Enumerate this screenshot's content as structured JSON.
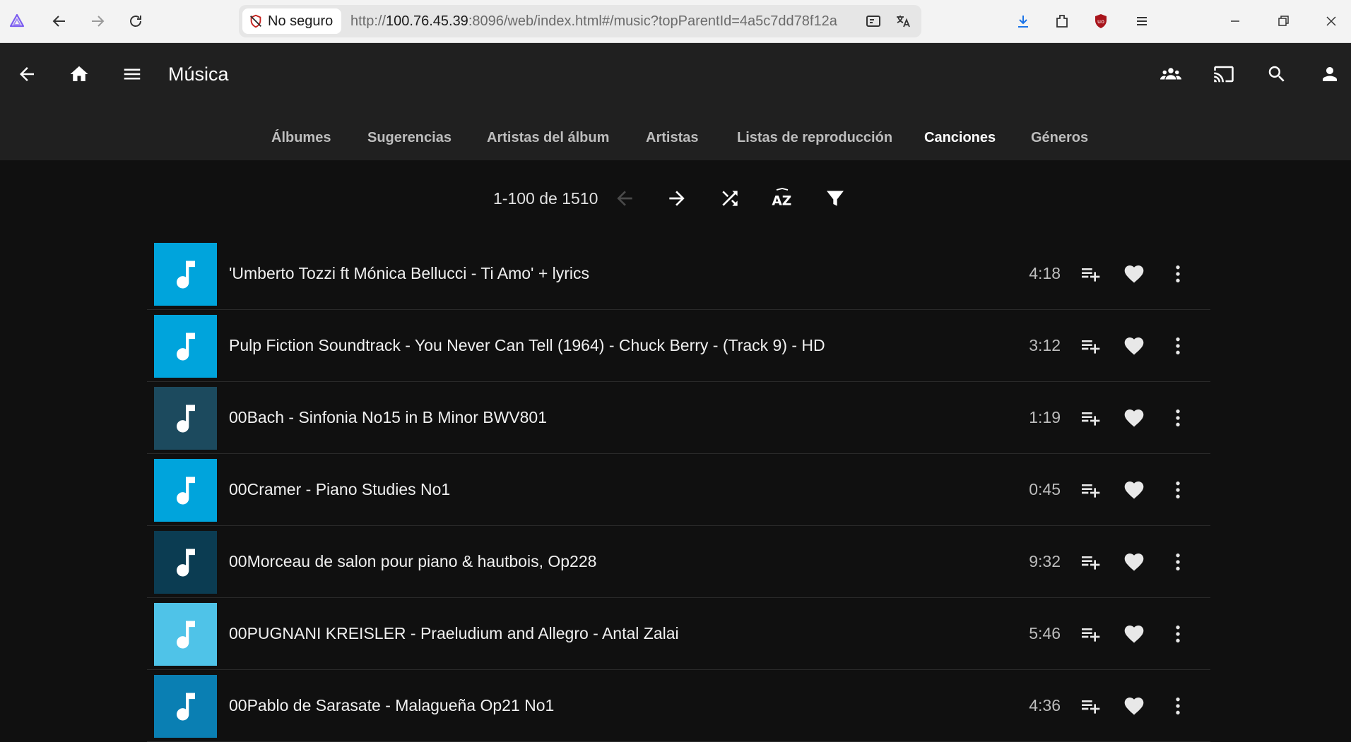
{
  "browser": {
    "security_label": "No seguro",
    "url_prefix": "http://",
    "url_host": "100.76.45.39",
    "url_rest": ":8096/web/index.html#/music?topParentId=4a5c7dd78f12a"
  },
  "header": {
    "title": "Música"
  },
  "tabs": [
    {
      "label": "Álbumes"
    },
    {
      "label": "Sugerencias"
    },
    {
      "label": "Artistas del álbum"
    },
    {
      "label": "Artistas"
    },
    {
      "label": "Listas de reproducción"
    },
    {
      "label": "Canciones",
      "active": true
    },
    {
      "label": "Géneros"
    }
  ],
  "paging": {
    "text": "1-100 de 1510"
  },
  "songs": [
    {
      "title": "'Umberto Tozzi ft Mónica Bellucci - Ti Amo' + lyrics",
      "duration": "4:18",
      "color": "#00a4dc"
    },
    {
      "title": "Pulp Fiction Soundtrack - You Never Can Tell (1964) - Chuck Berry - (Track 9) - HD",
      "duration": "3:12",
      "color": "#00a4dc"
    },
    {
      "title": "00Bach - Sinfonia No15 in B Minor BWV801",
      "duration": "1:19",
      "color": "#1c4a5e"
    },
    {
      "title": "00Cramer - Piano Studies No1",
      "duration": "0:45",
      "color": "#00a4dc"
    },
    {
      "title": "00Morceau de salon pour piano & hautbois, Op228",
      "duration": "9:32",
      "color": "#0b3c52"
    },
    {
      "title": "00PUGNANI KREISLER - Praeludium and Allegro - Antal Zalai",
      "duration": "5:46",
      "color": "#4fc3e8"
    },
    {
      "title": "00Pablo de Sarasate - Malagueña Op21 No1",
      "duration": "4:36",
      "color": "#0a7fb3"
    }
  ],
  "colors": {
    "accent": "#00a4dc",
    "header_bg": "#202020",
    "content_bg": "#101010"
  }
}
